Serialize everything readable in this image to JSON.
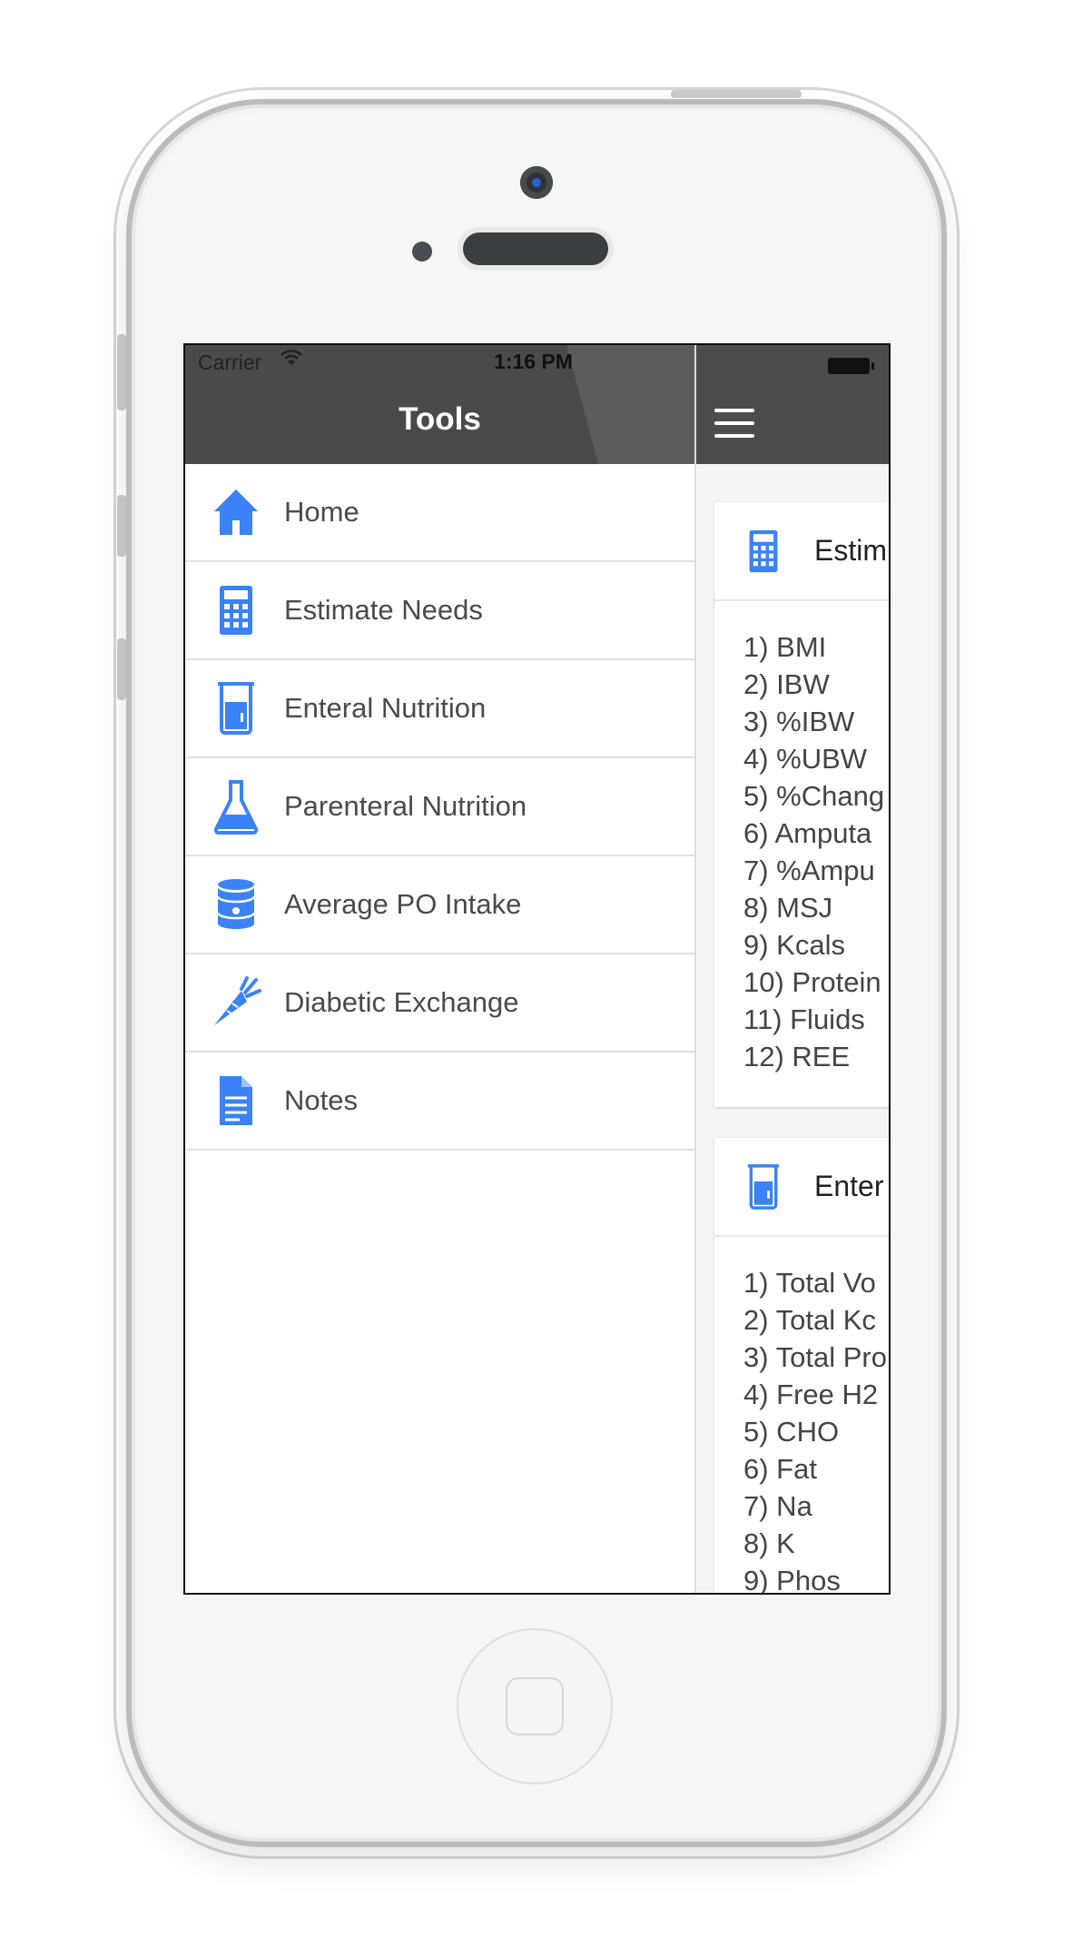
{
  "status_bar": {
    "carrier": "Carrier",
    "time": "1:16 PM"
  },
  "drawer": {
    "title": "Tools",
    "items": [
      {
        "label": "Home",
        "icon": "home-icon"
      },
      {
        "label": "Estimate Needs",
        "icon": "calculator-icon"
      },
      {
        "label": "Enteral Nutrition",
        "icon": "beaker-icon"
      },
      {
        "label": "Parenteral Nutrition",
        "icon": "flask-icon"
      },
      {
        "label": "Average PO Intake",
        "icon": "can-icon"
      },
      {
        "label": "Diabetic Exchange",
        "icon": "carrot-icon"
      },
      {
        "label": "Notes",
        "icon": "document-icon"
      }
    ]
  },
  "main": {
    "cards": [
      {
        "title": "Estim",
        "icon": "calculator-icon",
        "items": [
          "1) BMI",
          "2) IBW",
          "3) %IBW",
          "4) %UBW",
          "5) %Chang",
          "6) Amputa",
          "7) %Ampu",
          "8) MSJ",
          "9) Kcals",
          "10) Protein",
          "11) Fluids",
          "12) REE"
        ]
      },
      {
        "title": "Enter",
        "icon": "beaker-icon",
        "items": [
          "1) Total Vo",
          "2) Total Kc",
          "3) Total Pro",
          "4) Free H2",
          "5) CHO",
          "6) Fat",
          "7) Na",
          "8) K",
          "9) Phos"
        ]
      }
    ]
  },
  "colors": {
    "accent": "#3b82f6",
    "header": "#4a4a4a",
    "text": "#4a4a4a"
  }
}
